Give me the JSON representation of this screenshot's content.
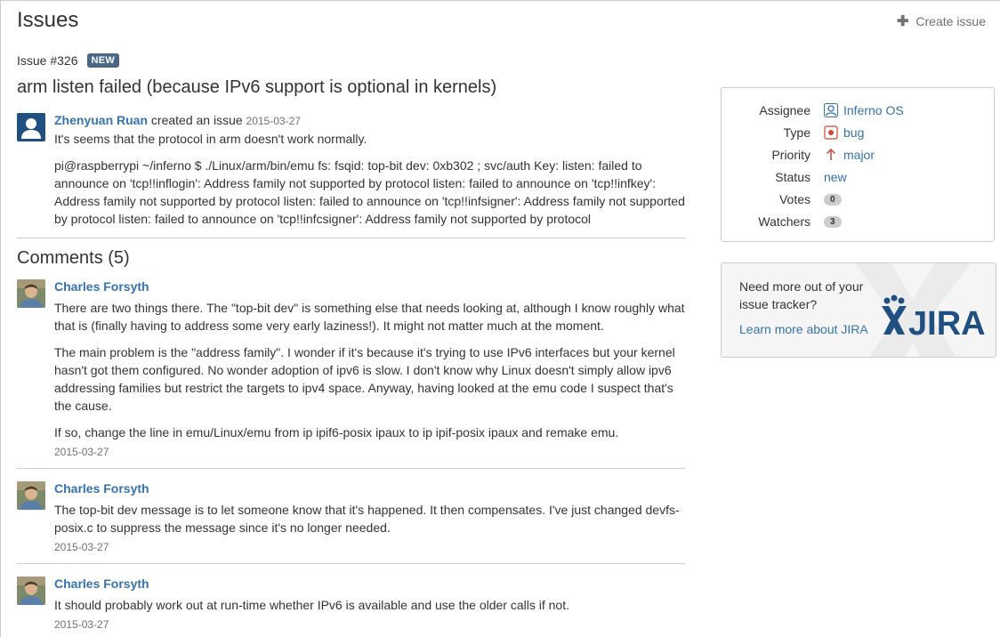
{
  "header": {
    "title": "Issues",
    "create_label": "Create issue"
  },
  "issue": {
    "id_label": "Issue #326",
    "status_badge": "NEW",
    "title": "arm listen failed (because IPv6 support is optional in kernels)",
    "author": "Zhenyuan Ruan",
    "action": "created an issue",
    "date": "2015-03-27",
    "body": [
      "It's seems that the protocol in arm doesn't work normally.",
      "pi@raspberrypi ~/inferno $ ./Linux/arm/bin/emu fs: fsqid: top-bit dev: 0xb302 ; svc/auth Key: listen: failed to announce on 'tcp!!inflogin': Address family not supported by protocol listen: failed to announce on 'tcp!!infkey': Address family not supported by protocol listen: failed to announce on 'tcp!!infsigner': Address family not supported by protocol listen: failed to announce on 'tcp!!infcsigner': Address family not supported by protocol"
    ]
  },
  "comments": {
    "title": "Comments (5)",
    "items": [
      {
        "author": "Charles Forsyth",
        "paragraphs": [
          "There are two things there. The \"top-bit dev\" is something else that needs looking at, although I know roughly what that is (finally having to address some very early laziness!). It might not matter much at the moment.",
          "The main problem is the \"address family\". I wonder if it's because it's trying to use IPv6 interfaces but your kernel hasn't got them configured. No wonder adoption of ipv6 is slow. I don't know why Linux doesn't simply allow ipv6 addressing families but restrict the targets to ipv4 space. Anyway, having looked at the emu code I suspect that's the cause.",
          "If so, change the line in emu/Linux/emu from ip ipif6-posix ipaux to ip ipif-posix ipaux and remake emu."
        ],
        "date": "2015-03-27"
      },
      {
        "author": "Charles Forsyth",
        "paragraphs": [
          "The top-bit dev message is to let someone know that it's happened. It then compensates. I've just changed devfs-posix.c to suppress the message since it's no longer needed."
        ],
        "date": "2015-03-27"
      },
      {
        "author": "Charles Forsyth",
        "paragraphs": [
          "It should probably work out at run-time whether IPv6 is available and use the older calls if not."
        ],
        "date": "2015-03-27"
      }
    ]
  },
  "sidebar": {
    "assignee_label": "Assignee",
    "assignee_value": "Inferno OS",
    "type_label": "Type",
    "type_value": "bug",
    "priority_label": "Priority",
    "priority_value": "major",
    "status_label": "Status",
    "status_value": "new",
    "votes_label": "Votes",
    "votes_value": "0",
    "watchers_label": "Watchers",
    "watchers_value": "3"
  },
  "promo": {
    "text": "Need more out of your issue tracker?",
    "link": "Learn more about JIRA",
    "logo_text": "JIRA"
  },
  "colors": {
    "link": "#3572b0",
    "badge_new": "#4a6785",
    "jira_blue": "#205081",
    "priority_red": "#d04437"
  },
  "icons": {
    "create": "plus-icon",
    "assignee": "user-group-icon",
    "type": "bug-icon",
    "priority": "arrow-up-icon"
  }
}
